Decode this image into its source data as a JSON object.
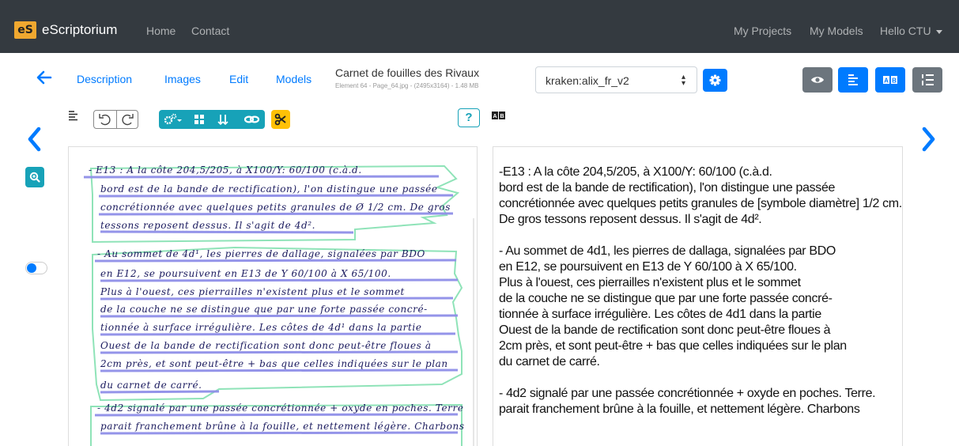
{
  "navbar": {
    "logo_text": "eS",
    "brand": "eScriptorium",
    "links": [
      "Home",
      "Contact"
    ],
    "right_links": [
      "My Projects",
      "My Models"
    ],
    "user_menu": "Hello CTU"
  },
  "doc_header": {
    "tabs": [
      "Description",
      "Images",
      "Edit",
      "Models"
    ],
    "title": "Carnet de fouilles des Rivaux",
    "meta": "Element 64 - Page_64.jpg - (2495x3164) - 1.48 MB",
    "model_select": "kraken:alix_fr_v2"
  },
  "toolbar": {
    "help_label": "?"
  },
  "colors": {
    "navbar_bg": "#343a40",
    "primary": "#007bff",
    "info": "#17a2b8",
    "warning": "#ffc107",
    "secondary": "#6c757d",
    "region_outline": "#8fe3b8",
    "line_highlight": "#8f8fe8"
  },
  "image_text": {
    "lines": [
      "- E13 : A la côte 204,5/205, à X100/Y: 60/100 (c.à.d.",
      "bord est de la bande de rectification), l'on distingue une passée",
      "concrétionnée avec quelques petits granules de Ø 1/2 cm. De gros",
      "tessons reposent dessus. Il s'agit de 4d².",
      "- Au sommet de 4d¹, les pierres de dallage, signalées par BDO",
      "en E12, se poursuivent en E13 de Y 60/100 à X 65/100.",
      "Plus à l'ouest, ces pierrailles n'existent plus et le sommet",
      "de la couche ne se distingue que par une forte passée concré-",
      "tionnée à surface irrégulière. Les côtes de 4d¹ dans la partie",
      "Ouest de la bande de rectification sont donc peut-être floues à",
      "2cm près, et sont peut-être + bas que celles indiquées sur le plan",
      "du carnet de carré.",
      "- 4d2 signalé par une passée concrétionnée + oxyde en poches. Terre",
      "parait franchement brûne à la fouille, et nettement légère. Charbons"
    ]
  },
  "transcription": {
    "lines": [
      "-E13 : A la côte 204,5/205, à X100/Y: 60/100 (c.à.d.",
      "bord est de la bande de rectification), l'on distingue une passée",
      "concrétionnée avec quelques petits granules de [symbole diamètre] 1/2 cm.",
      "De gros  tessons reposent dessus. Il s'agit de 4d².",
      "",
      "- Au sommet de 4d1, les pierres de dallaga, signalées par BDO",
      "en E12, se poursuivent en E13 de Y 60/100 à X 65/100.",
      "Plus à l'ouest, ces pierrailles n'existent plus et le sommet",
      "de la couche ne se distingue que par une forte passée concré-",
      "tionnée à surface irrégulière. Les côtes de 4d1 dans la partie",
      "Ouest de la bande de rectification sont donc peut-être floues à",
      "2cm près, et sont peut-être + bas que celles indiquées sur le plan",
      "du carnet de carré.",
      "",
      "- 4d2 signalé par une passée concrétionnée + oxyde en poches.  Terre.",
      "parait franchement brûne à la fouille, et nettement légère. Charbons"
    ]
  }
}
